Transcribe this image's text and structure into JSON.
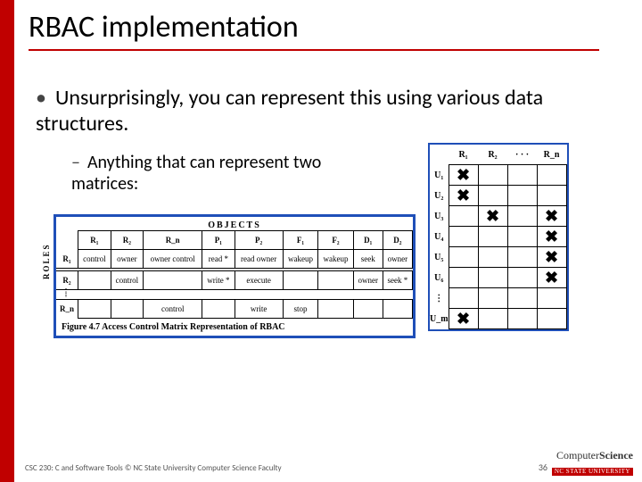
{
  "title": "RBAC implementation",
  "bullet1": "Unsurprisingly, you can represent this using various data structures.",
  "bullet2": "Anything that can represent two matrices:",
  "figure": {
    "objects_label": "OBJECTS",
    "roles_label": "ROLES",
    "col_headers": [
      "R₁",
      "R₂",
      "R_n",
      "P₁",
      "P₂",
      "F₁",
      "F₂",
      "D₁",
      "D₂"
    ],
    "row_labels": [
      "R₁",
      "R₂",
      "R_n"
    ],
    "rows": [
      [
        "control",
        "owner",
        "owner control",
        "read *",
        "read owner",
        "wakeup",
        "wakeup",
        "seek",
        "owner"
      ],
      [
        "",
        "control",
        "",
        "write *",
        "execute",
        "",
        "",
        "owner",
        "seek *"
      ],
      [
        "",
        "",
        "control",
        "",
        "write",
        "stop",
        "",
        "",
        ""
      ]
    ],
    "caption": "Figure 4.7  Access Control Matrix Representation of RBAC"
  },
  "grid2": {
    "col_headers": [
      "R₁",
      "R₂",
      "· · ·",
      "R_n"
    ],
    "row_labels": [
      "U₁",
      "U₂",
      "U₃",
      "U₄",
      "U₅",
      "U₆",
      "⋮",
      "U_m"
    ],
    "marks": [
      [
        true,
        false,
        false,
        false
      ],
      [
        true,
        false,
        false,
        false
      ],
      [
        false,
        true,
        false,
        true
      ],
      [
        false,
        false,
        false,
        true
      ],
      [
        false,
        false,
        false,
        true
      ],
      [
        false,
        false,
        false,
        true
      ],
      [
        false,
        false,
        false,
        false
      ],
      [
        true,
        false,
        false,
        false
      ]
    ]
  },
  "footer": "CSC 230: C and Software Tools © NC State University Computer Science Faculty",
  "slide_number": "36",
  "logo": {
    "line1_a": "Computer",
    "line1_b": "Science",
    "line2": "NC STATE UNIVERSITY"
  }
}
